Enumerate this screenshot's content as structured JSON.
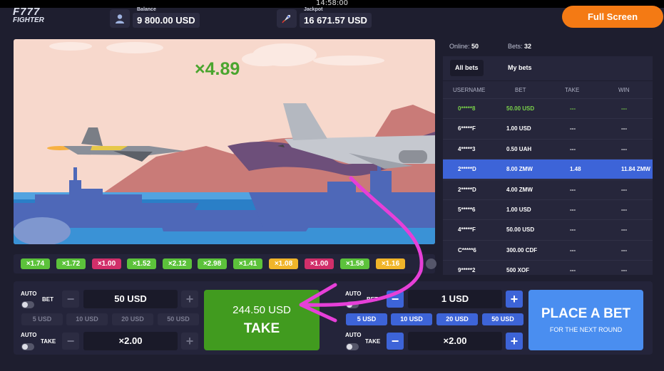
{
  "status_bar": {
    "time": "14:58:00"
  },
  "header": {
    "logo_line1": "F777",
    "logo_line2": "FIGHTER",
    "balance_label": "Balance",
    "balance_value": "9 800.00 USD",
    "jackpot_label": "Jackpot",
    "jackpot_value": "16 671.57 USD",
    "fullscreen_label": "Full Screen",
    "balance_icon": "user-icon",
    "jackpot_icon": "rocket-icon"
  },
  "game": {
    "multiplier": "×4.89"
  },
  "history": [
    {
      "value": "×1.74",
      "color": "#5cc23b"
    },
    {
      "value": "×1.72",
      "color": "#5cc23b"
    },
    {
      "value": "×1.00",
      "color": "#d12f6a"
    },
    {
      "value": "×1.52",
      "color": "#5cc23b"
    },
    {
      "value": "×2.12",
      "color": "#5cc23b"
    },
    {
      "value": "×2.98",
      "color": "#5cc23b"
    },
    {
      "value": "×1.41",
      "color": "#5cc23b"
    },
    {
      "value": "×1.08",
      "color": "#f0b52a"
    },
    {
      "value": "×1.00",
      "color": "#d12f6a"
    },
    {
      "value": "×1.58",
      "color": "#5cc23b"
    },
    {
      "value": "×1.16",
      "color": "#f0b52a"
    }
  ],
  "stats": {
    "online_label": "Online:",
    "online_value": "50",
    "bets_label": "Bets:",
    "bets_value": "32"
  },
  "tabs": {
    "all_bets": "All bets",
    "my_bets": "My bets"
  },
  "table": {
    "headers": [
      "USERNAME",
      "BET",
      "TAKE",
      "WIN"
    ],
    "rows": [
      {
        "username": "0*****8",
        "bet": "50.00 USD",
        "take": "---",
        "win": "---"
      },
      {
        "username": "6*****F",
        "bet": "1.00 USD",
        "take": "---",
        "win": "---"
      },
      {
        "username": "4*****3",
        "bet": "0.50 UAH",
        "take": "---",
        "win": "---"
      },
      {
        "username": "2*****D",
        "bet": "8.00 ZMW",
        "take": "1.48",
        "win": "11.84 ZMW"
      },
      {
        "username": "2*****D",
        "bet": "4.00 ZMW",
        "take": "---",
        "win": "---"
      },
      {
        "username": "5*****6",
        "bet": "1.00 USD",
        "take": "---",
        "win": "---"
      },
      {
        "username": "4*****F",
        "bet": "50.00 USD",
        "take": "---",
        "win": "---"
      },
      {
        "username": "C*****6",
        "bet": "300.00 CDF",
        "take": "---",
        "win": "---"
      },
      {
        "username": "9*****2",
        "bet": "500 XOF",
        "take": "---",
        "win": "---"
      }
    ]
  },
  "left_bet": {
    "auto_label": "AUTO",
    "bet_label": "BET",
    "take_label": "TAKE",
    "bet_value": "50 USD",
    "take_value": "×2.00",
    "chips": [
      "5 USD",
      "10 USD",
      "20 USD",
      "50 USD"
    ],
    "minus": "−",
    "plus": "+",
    "take_button_amount": "244.50 USD",
    "take_button_label": "TAKE"
  },
  "right_bet": {
    "auto_label": "AUTO",
    "bet_label": "BET",
    "take_label": "TAKE",
    "bet_value": "1 USD",
    "take_value": "×2.00",
    "chips": [
      "5 USD",
      "10 USD",
      "20 USD",
      "50 USD"
    ],
    "minus": "−",
    "plus": "+",
    "place_button_label": "PLACE A BET",
    "place_button_sub": "FOR THE NEXT ROUND"
  },
  "colors": {
    "accent_orange": "#f47a14",
    "accent_blue": "#3d64d8",
    "take_green": "#419b1f",
    "annotation_magenta": "#e63fd8"
  }
}
